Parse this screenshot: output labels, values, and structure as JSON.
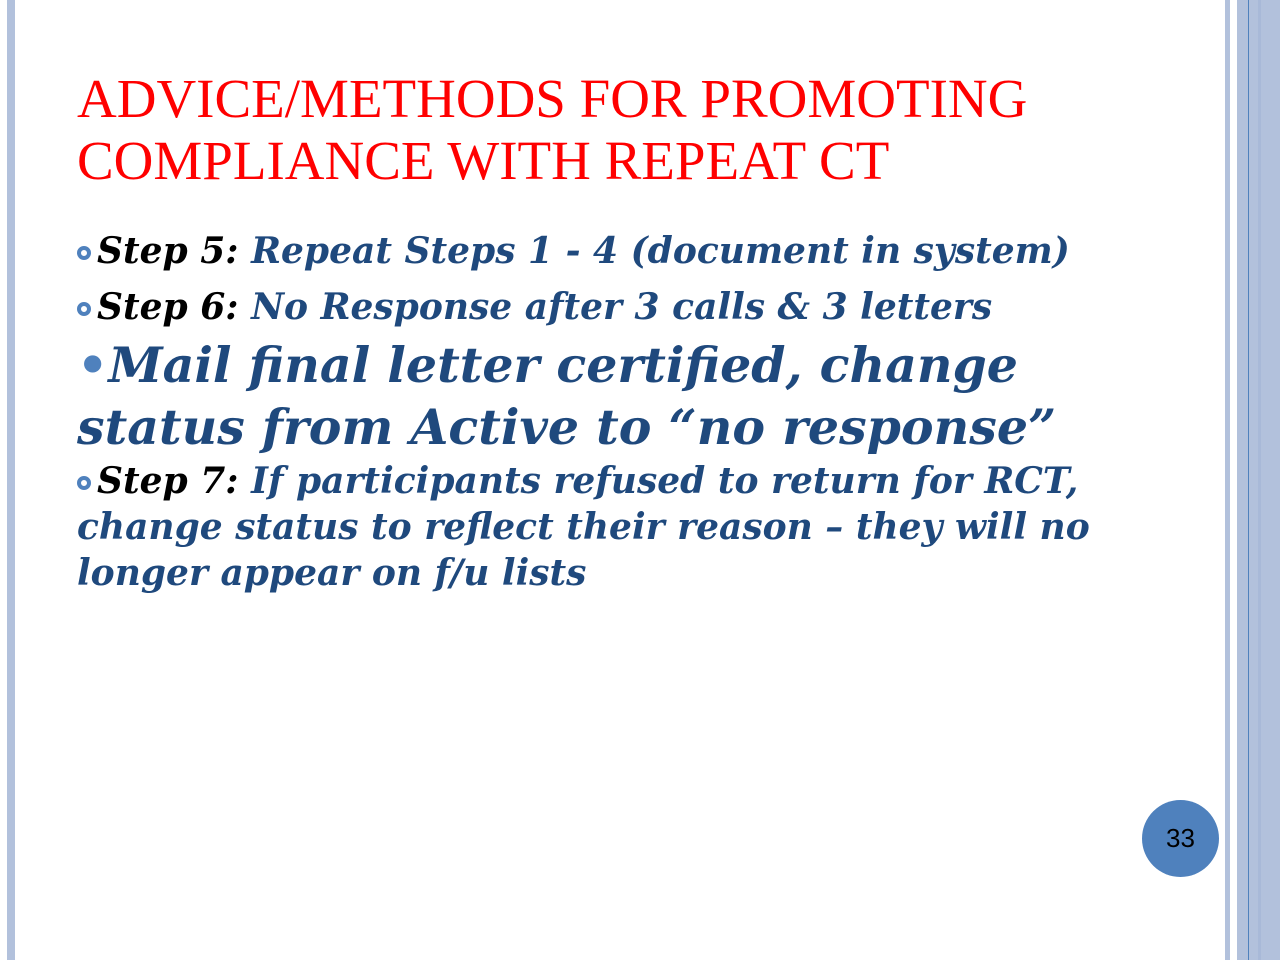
{
  "title": "ADVICE/METHODS FOR PROMOTING COMPLIANCE WITH REPEAT CT",
  "items": [
    {
      "label": "Step 5:",
      "text": " Repeat Steps 1 - 4 (document in system)"
    },
    {
      "label": "Step 6:",
      "text": " No Response after 3 calls & 3 letters"
    },
    {
      "text": "Mail final letter certified, change status from Active to “no response”"
    },
    {
      "label": "Step 7:",
      "text": " If participants refused to return for RCT, change status to reflect their reason – they will no longer appear on f/u lists"
    }
  ],
  "page_number": "33"
}
